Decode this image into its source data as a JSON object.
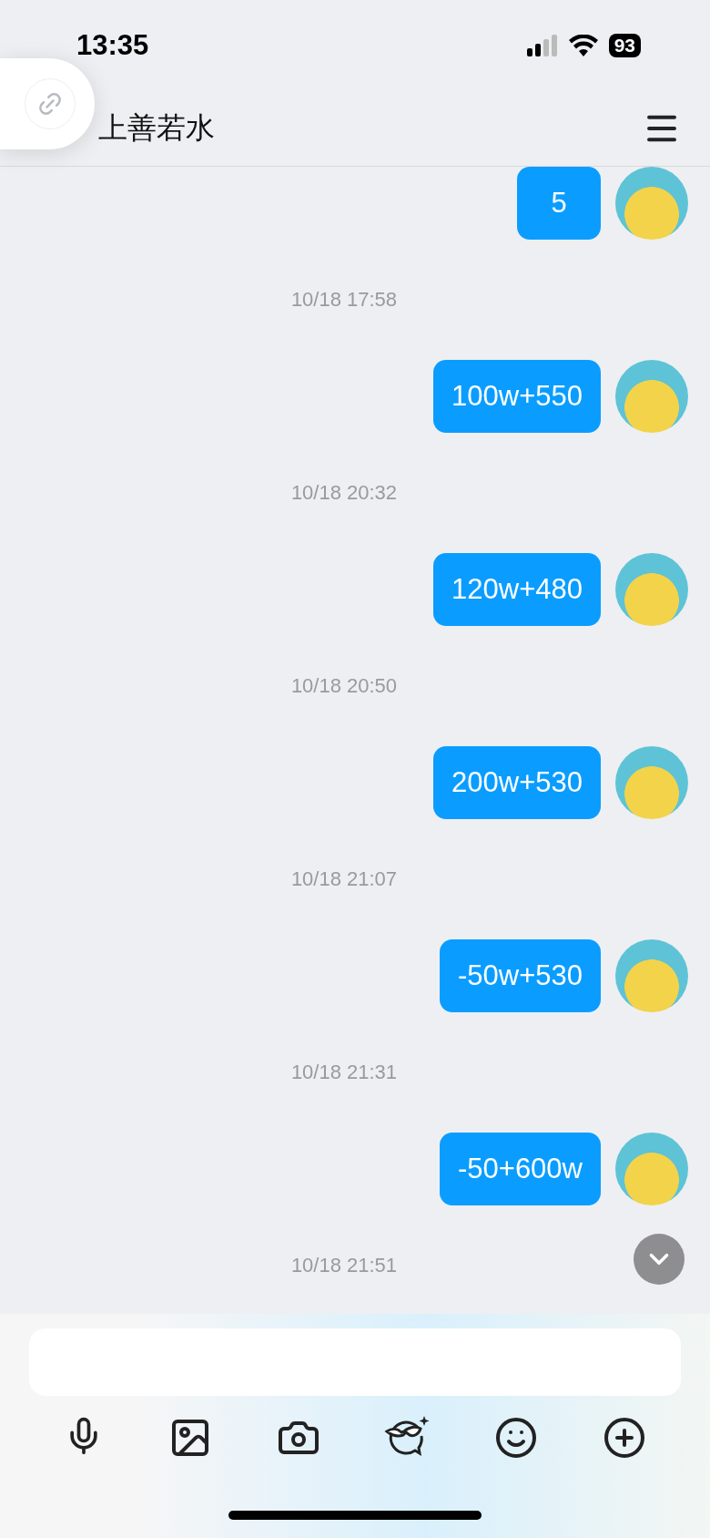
{
  "status_bar": {
    "time": "13:35",
    "battery": "93"
  },
  "header": {
    "title": "上善若水"
  },
  "messages": [
    {
      "kind": "bubble",
      "text": "5"
    },
    {
      "kind": "time",
      "text": "10/18 17:58"
    },
    {
      "kind": "bubble",
      "text": "100w+550"
    },
    {
      "kind": "time",
      "text": "10/18 20:32"
    },
    {
      "kind": "bubble",
      "text": "120w+480"
    },
    {
      "kind": "time",
      "text": "10/18 20:50"
    },
    {
      "kind": "bubble",
      "text": "200w+530"
    },
    {
      "kind": "time",
      "text": "10/18 21:07"
    },
    {
      "kind": "bubble",
      "text": "-50w+530"
    },
    {
      "kind": "time",
      "text": "10/18 21:31"
    },
    {
      "kind": "bubble",
      "text": "-50+600w"
    },
    {
      "kind": "time",
      "text": "10/18 21:51"
    }
  ]
}
